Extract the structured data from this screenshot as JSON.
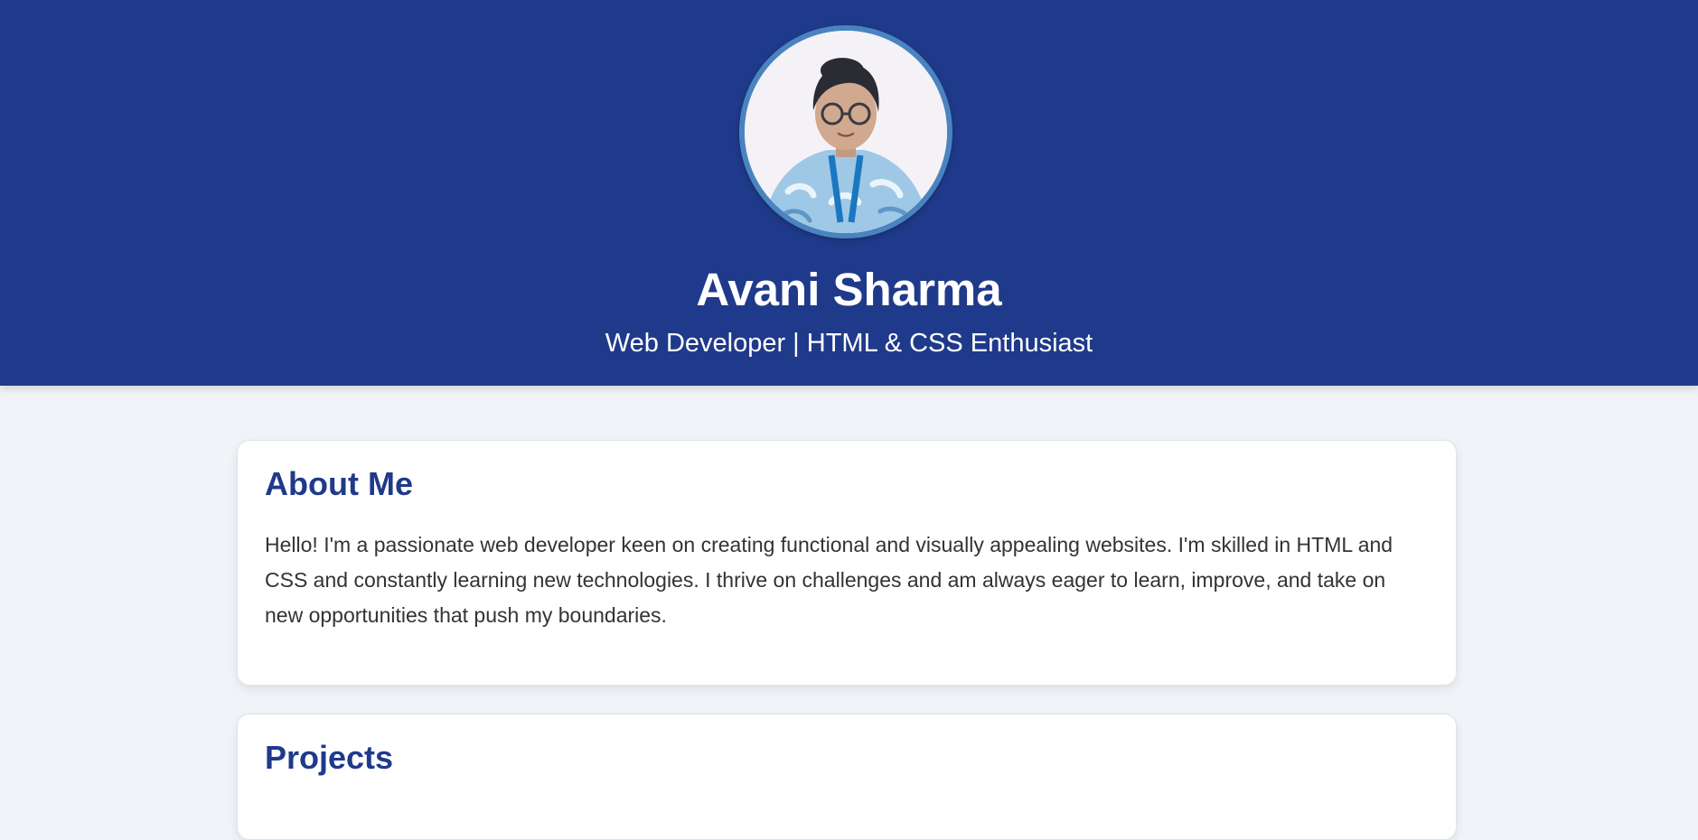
{
  "header": {
    "name": "Avani Sharma",
    "tagline": "Web Developer | HTML & CSS Enthusiast",
    "background_color": "#1f3a8a",
    "avatar_border_color": "#4a84c0"
  },
  "sections": {
    "about": {
      "title": "About Me",
      "text": "Hello! I'm a passionate web developer keen on creating functional and visually appealing websites. I'm skilled in HTML and CSS and constantly learning new technologies. I thrive on challenges and am always eager to learn, improve, and take on new opportunities that push my boundaries."
    },
    "projects": {
      "title": "Projects"
    }
  },
  "colors": {
    "accent": "#1f3a8a",
    "page_background": "#f0f3f7",
    "card_background": "#ffffff",
    "body_text": "#333333"
  }
}
